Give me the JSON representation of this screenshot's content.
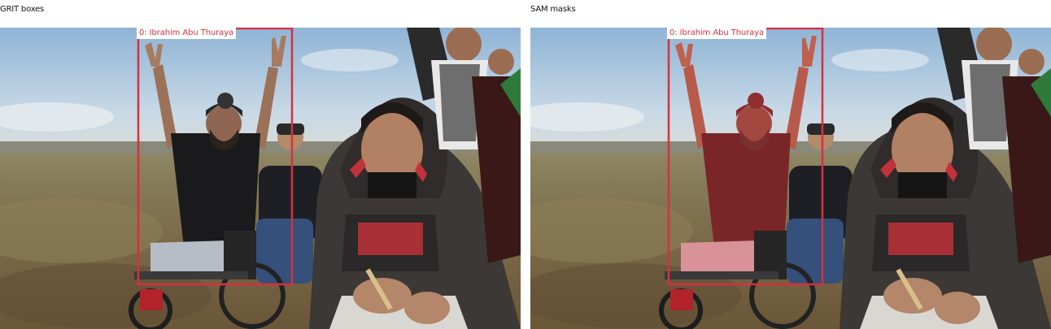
{
  "panels": {
    "left": {
      "title": "GRIT boxes",
      "box_label": "0: Ibrahim Abu Thuraya"
    },
    "right": {
      "title": "SAM masks",
      "box_label": "0: Ibrahim Abu Thuraya"
    }
  },
  "colors": {
    "box": "#d6303e",
    "mask": "#c0303a"
  }
}
